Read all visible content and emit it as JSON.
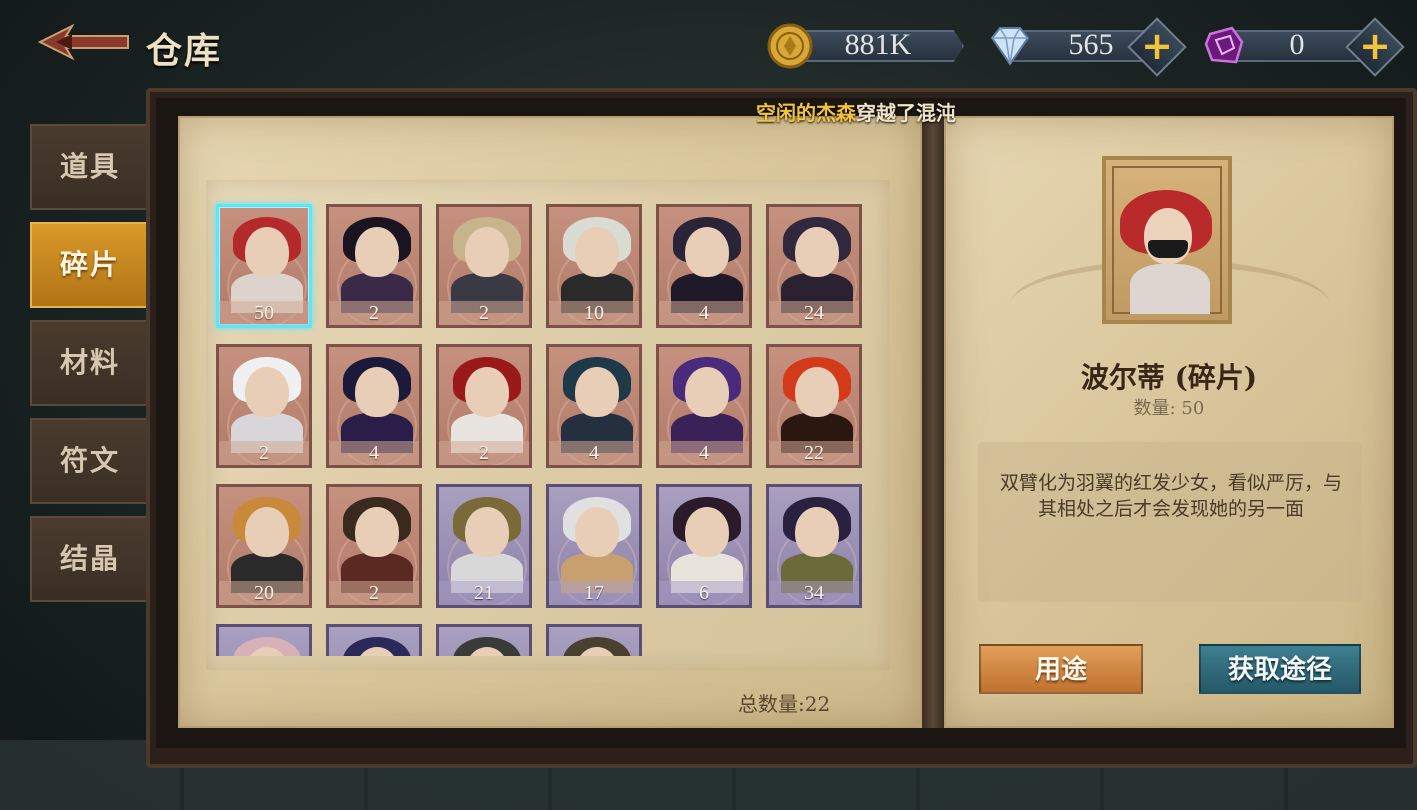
{
  "header": {
    "title": "仓库",
    "currencies": [
      {
        "name": "gold",
        "icon": "gold-coin-icon",
        "value": "881K",
        "color": "#e0b040"
      },
      {
        "name": "diamond",
        "icon": "diamond-icon",
        "value": "565",
        "color": "#a8c8ee"
      },
      {
        "name": "rune",
        "icon": "purple-crystal-icon",
        "value": "0",
        "color": "#c050d0"
      }
    ]
  },
  "notice": {
    "highlight": "空闲的杰森",
    "text": "穿越了混沌"
  },
  "sidebar": {
    "tabs": [
      {
        "label": "道具",
        "active": false
      },
      {
        "label": "碎片",
        "active": true
      },
      {
        "label": "材料",
        "active": false
      },
      {
        "label": "符文",
        "active": false
      },
      {
        "label": "结晶",
        "active": false
      }
    ]
  },
  "inventory": {
    "total_label": "总数量:22",
    "items": [
      {
        "count": "50",
        "rarity": "red",
        "hair": "#b42a2a",
        "body": "#dcd4cc",
        "selected": true
      },
      {
        "count": "2",
        "rarity": "red",
        "hair": "#1a1420",
        "body": "#3a2a48"
      },
      {
        "count": "2",
        "rarity": "red",
        "hair": "#c8b48a",
        "body": "#3a3a44"
      },
      {
        "count": "10",
        "rarity": "red",
        "hair": "#d8dcd2",
        "body": "#2a2a2a"
      },
      {
        "count": "4",
        "rarity": "red",
        "hair": "#2a2438",
        "body": "#1e1a2a"
      },
      {
        "count": "24",
        "rarity": "red",
        "hair": "#32283e",
        "body": "#2a2230"
      },
      {
        "count": "2",
        "rarity": "red",
        "hair": "#f0f0f2",
        "body": "#d8d6d8"
      },
      {
        "count": "4",
        "rarity": "red",
        "hair": "#1c1a3a",
        "body": "#2a1e48"
      },
      {
        "count": "2",
        "rarity": "red",
        "hair": "#9a1a1a",
        "body": "#e8e4e0"
      },
      {
        "count": "4",
        "rarity": "red",
        "hair": "#1e3a48",
        "body": "#243040"
      },
      {
        "count": "4",
        "rarity": "red",
        "hair": "#4a2a7a",
        "body": "#3a2258"
      },
      {
        "count": "22",
        "rarity": "red",
        "hair": "#d23a1a",
        "body": "#2a1810"
      },
      {
        "count": "20",
        "rarity": "red",
        "hair": "#c88a3a",
        "body": "#2a2a2a"
      },
      {
        "count": "2",
        "rarity": "red",
        "hair": "#3a2a1e",
        "body": "#5a2a22"
      },
      {
        "count": "21",
        "rarity": "purple",
        "hair": "#7a6a3a",
        "body": "#d8d8d8"
      },
      {
        "count": "17",
        "rarity": "purple",
        "hair": "#e0e0e0",
        "body": "#c8a070"
      },
      {
        "count": "6",
        "rarity": "purple",
        "hair": "#2a1a2a",
        "body": "#e8e4dc"
      },
      {
        "count": "34",
        "rarity": "purple",
        "hair": "#2a2040",
        "body": "#6a6a3a"
      },
      {
        "count": "",
        "rarity": "purple",
        "hair": "#d8b0b8",
        "body": "#d8b0b8"
      },
      {
        "count": "",
        "rarity": "purple",
        "hair": "#2a2a5a",
        "body": "#2a2a5a"
      },
      {
        "count": "",
        "rarity": "purple",
        "hair": "#3a3a3a",
        "body": "#3a3a3a"
      },
      {
        "count": "",
        "rarity": "purple",
        "hair": "#4a4030",
        "body": "#4a4030"
      }
    ]
  },
  "detail": {
    "name": "波尔蒂 (碎片)",
    "quantity": "数量:  50",
    "description": "双臂化为羽翼的红发少女，看似严厉，与其相处之后才会发现她的另一面",
    "use_button": "用途",
    "source_button": "获取途径"
  }
}
